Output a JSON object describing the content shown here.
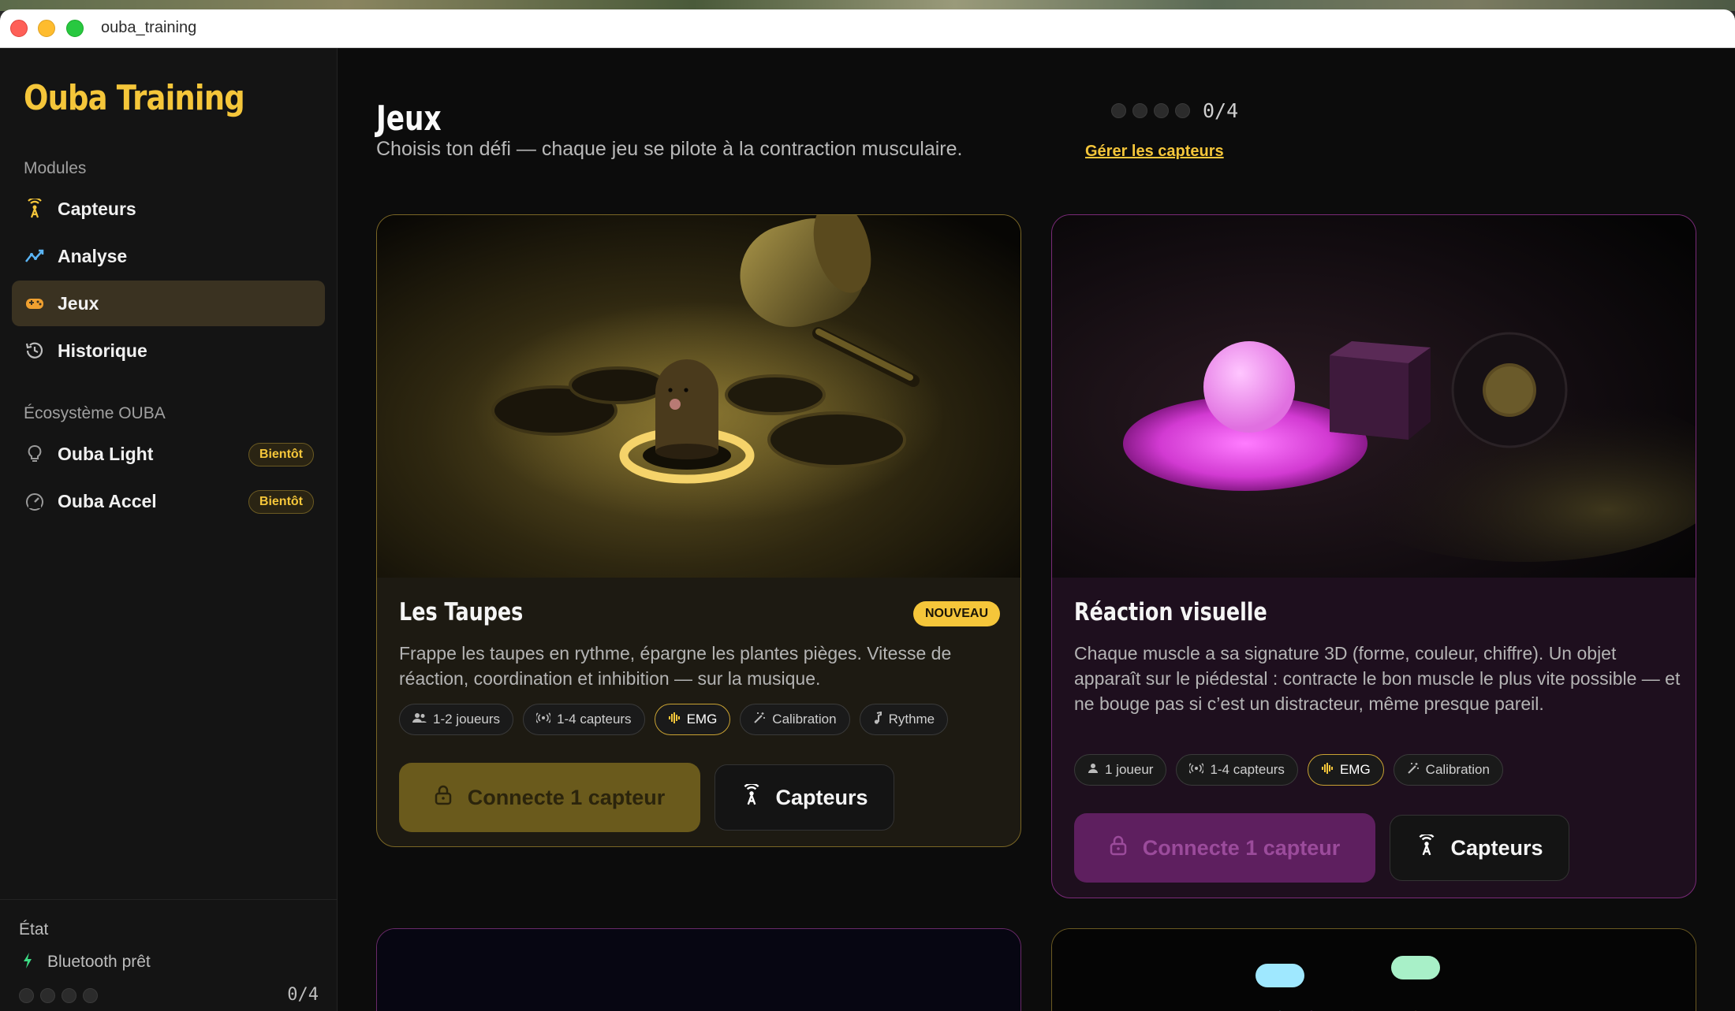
{
  "window": {
    "title": "ouba_training"
  },
  "sidebar": {
    "brand": "Ouba Training",
    "modules_label": "Modules",
    "items": [
      {
        "label": "Capteurs",
        "icon": "antenna-icon"
      },
      {
        "label": "Analyse",
        "icon": "trend-chart-icon"
      },
      {
        "label": "Jeux",
        "icon": "gamepad-icon",
        "active": true
      },
      {
        "label": "Historique",
        "icon": "history-icon"
      }
    ],
    "ecosystem_label": "Écosystème OUBA",
    "ecosystem": [
      {
        "label": "Ouba Light",
        "icon": "lightbulb-icon",
        "badge": "Bientôt"
      },
      {
        "label": "Ouba Accel",
        "icon": "gauge-icon",
        "badge": "Bientôt"
      }
    ],
    "state": {
      "title": "État",
      "bluetooth": "Bluetooth prêt",
      "count": "0/4"
    }
  },
  "header": {
    "title": "Jeux",
    "subtitle": "Choisis ton défi — chaque jeu se pilote à la contraction musculaire.",
    "sensor_count": "0/4",
    "manage_link": "Gérer les capteurs"
  },
  "cards": [
    {
      "title": "Les Taupes",
      "badge": "NOUVEAU",
      "description": "Frappe les taupes en rythme, épargne les plantes pièges. Vitesse de réaction, coordination et inhibition — sur la musique.",
      "tags": [
        "1-2 joueurs",
        "1-4 capteurs",
        "EMG",
        "Calibration",
        "Rythme"
      ],
      "primary_button": "Connecte 1 capteur",
      "secondary_button": "Capteurs"
    },
    {
      "title": "Réaction visuelle",
      "description": "Chaque muscle a sa signature 3D (forme, couleur, chiffre). Un objet apparaît sur le piédestal : contracte le bon muscle le plus vite possible — et ne bouge pas si c’est un distracteur, même presque pareil.",
      "tags": [
        "1 joueur",
        "1-4 capteurs",
        "EMG",
        "Calibration"
      ],
      "primary_button": "Connecte 1 capteur",
      "secondary_button": "Capteurs"
    }
  ],
  "colors": {
    "accent": "#f5c63a",
    "pink": "#e040e0",
    "bg": "#0c0c0c"
  }
}
